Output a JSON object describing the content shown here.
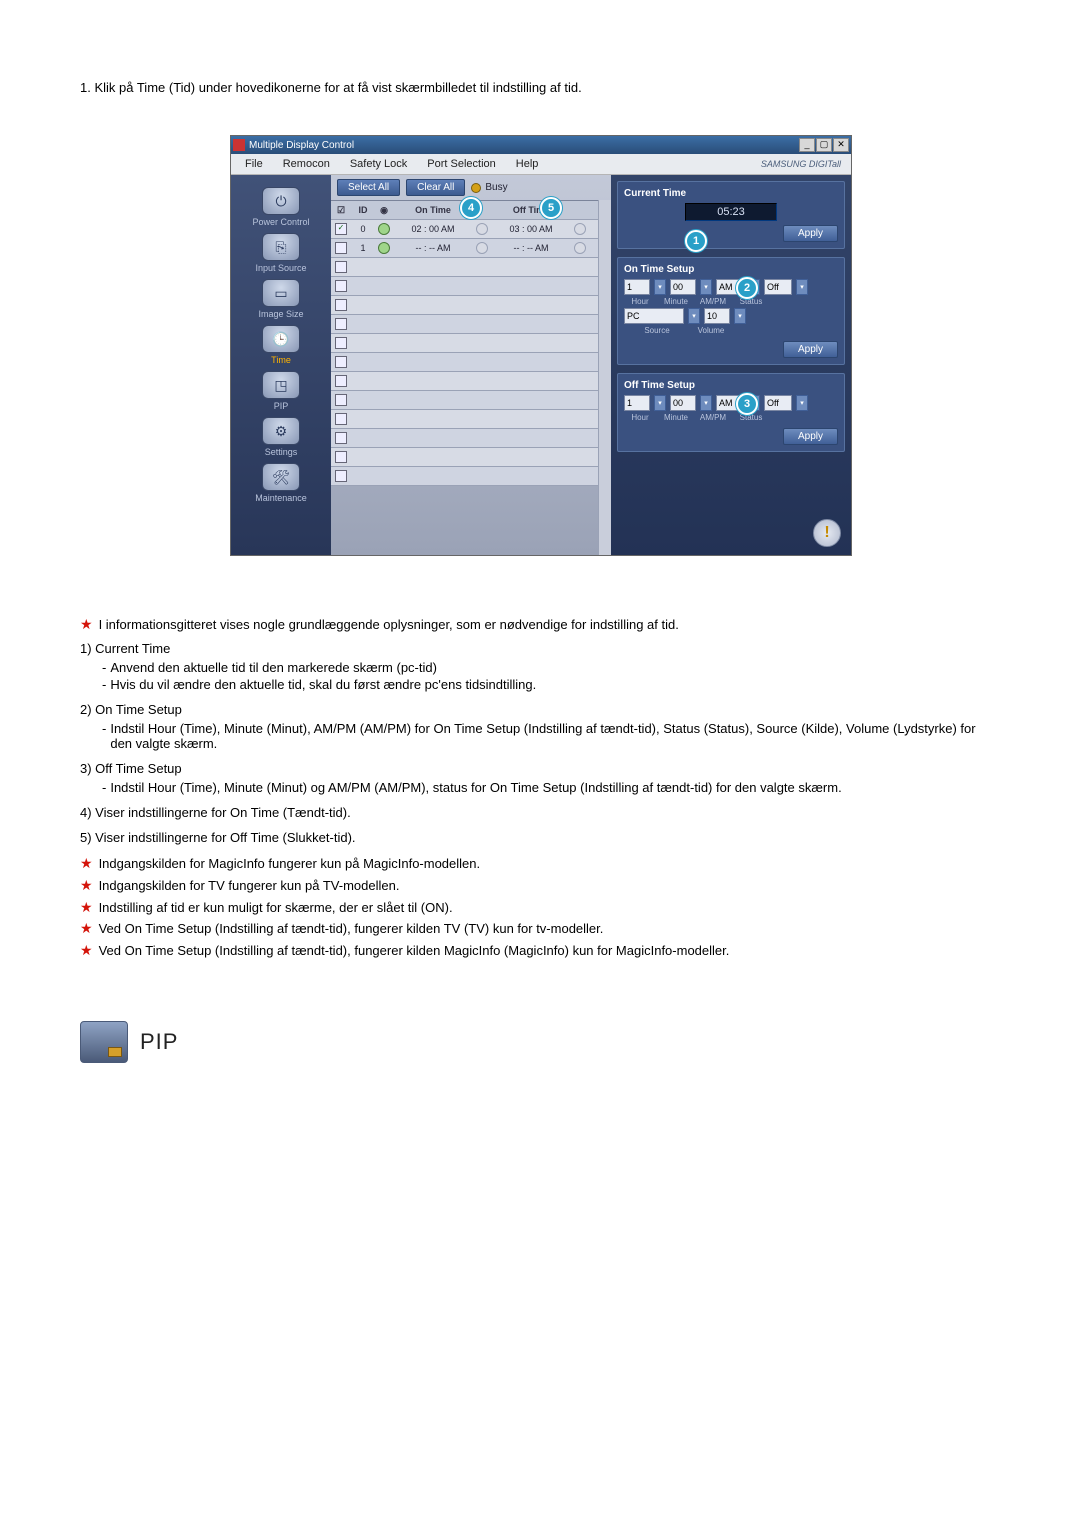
{
  "intro": "1.  Klik på Time (Tid) under hovedikonerne for at få vist skærmbilledet til indstilling af tid.",
  "window": {
    "title": "Multiple Display Control",
    "menus": [
      "File",
      "Remocon",
      "Safety Lock",
      "Port Selection",
      "Help"
    ],
    "brand": "SAMSUNG DIGITall",
    "sidebar": [
      {
        "label": "Power Control"
      },
      {
        "label": "Input Source"
      },
      {
        "label": "Image Size"
      },
      {
        "label": "Time",
        "active": true
      },
      {
        "label": "PIP"
      },
      {
        "label": "Settings"
      },
      {
        "label": "Maintenance"
      }
    ],
    "toolbar": {
      "selectAll": "Select All",
      "clearAll": "Clear All",
      "busy": "Busy"
    },
    "grid": {
      "cols": [
        "",
        "ID",
        "",
        "On Time",
        "",
        "Off Time",
        ""
      ],
      "rows": [
        {
          "checked": true,
          "id": "0",
          "s1": "green",
          "on": "02 : 00 AM",
          "s2": "blank",
          "off": "03 : 00 AM",
          "s3": "blank"
        },
        {
          "checked": false,
          "id": "1",
          "s1": "green",
          "on": "-- : -- AM",
          "s2": "blank",
          "off": "-- : -- AM",
          "s3": "blank"
        }
      ],
      "emptyRows": 12
    },
    "right": {
      "current": {
        "title": "Current Time",
        "value": "05:23",
        "apply": "Apply"
      },
      "on": {
        "title": "On Time Setup",
        "hour": "1",
        "min": "00",
        "ampm": "AM",
        "status": "Off",
        "source": "PC",
        "volume": "10",
        "labs": {
          "hour": "Hour",
          "min": "Minute",
          "ampm": "AM/PM",
          "status": "Status",
          "source": "Source",
          "volume": "Volume"
        },
        "apply": "Apply"
      },
      "off": {
        "title": "Off Time Setup",
        "hour": "1",
        "min": "00",
        "ampm": "AM",
        "status": "Off",
        "labs": {
          "hour": "Hour",
          "min": "Minute",
          "ampm": "AM/PM",
          "status": "Status"
        },
        "apply": "Apply"
      }
    },
    "callouts": {
      "1": "1",
      "2": "2",
      "3": "3",
      "4": "4",
      "5": "5"
    }
  },
  "notes": {
    "lead": "I informationsgitteret vises nogle grundlæggende oplysninger, som er nødvendige for indstilling af tid.",
    "items": [
      {
        "n": "1)",
        "title": "Current Time",
        "lines": [
          "Anvend den aktuelle tid til den markerede skærm (pc-tid)",
          "Hvis du vil ændre den aktuelle tid, skal du først ændre pc'ens tidsindtilling."
        ]
      },
      {
        "n": "2)",
        "title": "On Time Setup",
        "lines": [
          "Indstil Hour (Time), Minute (Minut), AM/PM (AM/PM) for On Time Setup (Indstilling af tændt-tid), Status (Status), Source (Kilde), Volume (Lydstyrke) for den valgte skærm."
        ]
      },
      {
        "n": "3)",
        "title": "Off Time Setup",
        "lines": [
          "Indstil Hour (Time), Minute (Minut) og AM/PM (AM/PM), status for On Time Setup (Indstilling af tændt-tid) for den valgte skærm."
        ]
      },
      {
        "n": "4)",
        "title": "Viser indstillingerne for On Time (Tændt-tid).",
        "lines": []
      },
      {
        "n": "5)",
        "title": "Viser indstillingerne for Off Time (Slukket-tid).",
        "lines": []
      }
    ],
    "stars": [
      "Indgangskilden for MagicInfo fungerer kun på MagicInfo-modellen.",
      "Indgangskilden for TV fungerer kun på TV-modellen.",
      "Indstilling af tid er kun muligt for skærme, der er slået til (ON).",
      "Ved On Time Setup (Indstilling af tændt-tid), fungerer kilden TV (TV) kun for tv-modeller.",
      "Ved On Time Setup (Indstilling af tændt-tid), fungerer kilden MagicInfo (MagicInfo) kun for MagicInfo-modeller."
    ]
  },
  "pip": {
    "title": "PIP"
  }
}
